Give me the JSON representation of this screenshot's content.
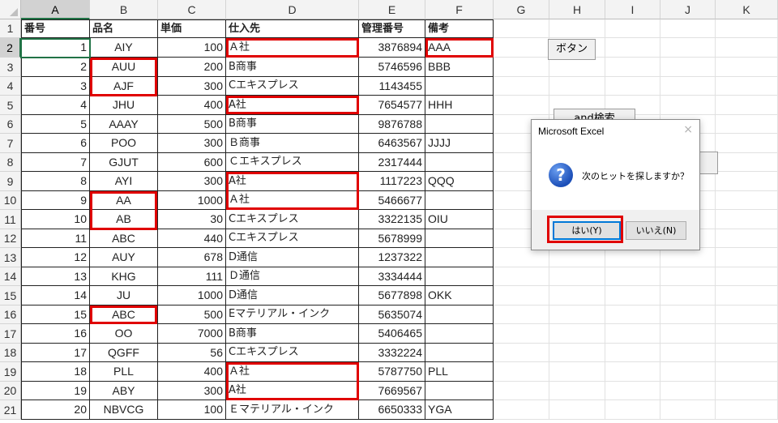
{
  "column_headers": [
    "A",
    "B",
    "C",
    "D",
    "E",
    "F",
    "G",
    "H",
    "I",
    "J",
    "K"
  ],
  "row_headers": [
    "1",
    "2",
    "3",
    "4",
    "5",
    "6",
    "7",
    "8",
    "9",
    "10",
    "11",
    "12",
    "13",
    "14",
    "15",
    "16",
    "17",
    "18",
    "19",
    "20",
    "21"
  ],
  "table": {
    "headers": [
      "番号",
      "品名",
      "単価",
      "仕入先",
      "管理番号",
      "備考"
    ],
    "rows": [
      [
        "1",
        "AIY",
        "100",
        "Ａ社",
        "3876894",
        "AAA"
      ],
      [
        "2",
        "AUU",
        "200",
        "B商事",
        "5746596",
        "BBB"
      ],
      [
        "3",
        "AJF",
        "300",
        "Cエキスプレス",
        "1143455",
        ""
      ],
      [
        "4",
        "JHU",
        "400",
        "A社",
        "7654577",
        "HHH"
      ],
      [
        "5",
        "AAAY",
        "500",
        "B商事",
        "9876788",
        ""
      ],
      [
        "6",
        "POO",
        "300",
        "Ｂ商事",
        "6463567",
        "JJJJ"
      ],
      [
        "7",
        "GJUT",
        "600",
        "Ｃエキスプレス",
        "2317444",
        ""
      ],
      [
        "8",
        "AYI",
        "300",
        "A社",
        "1117223",
        "QQQ"
      ],
      [
        "9",
        "AA",
        "1000",
        "Ａ社",
        "5466677",
        ""
      ],
      [
        "10",
        "AB",
        "30",
        "Cエキスプレス",
        "3322135",
        "OIU"
      ],
      [
        "11",
        "ABC",
        "440",
        "Cエキスプレス",
        "5678999",
        ""
      ],
      [
        "12",
        "AUY",
        "678",
        "D通信",
        "1237322",
        ""
      ],
      [
        "13",
        "KHG",
        "111",
        "Ｄ通信",
        "3334444",
        ""
      ],
      [
        "14",
        "JU",
        "1000",
        "D通信",
        "5677898",
        "OKK"
      ],
      [
        "15",
        "ABC",
        "500",
        "Eマテリアル・インク",
        "5635074",
        ""
      ],
      [
        "16",
        "OO",
        "7000",
        "B商事",
        "5406465",
        ""
      ],
      [
        "17",
        "QGFF",
        "56",
        "Cエキスプレス",
        "3332224",
        ""
      ],
      [
        "18",
        "PLL",
        "400",
        "Ａ社",
        "5787750",
        "PLL"
      ],
      [
        "19",
        "ABY",
        "300",
        "A社",
        "7669567",
        ""
      ],
      [
        "20",
        "NBVCG",
        "100",
        "Ｅマテリアル・インク",
        "6650333",
        "YGA"
      ]
    ]
  },
  "sheet_buttons": {
    "button1_label": "ボタン",
    "button2_label": "and検索"
  },
  "dialog": {
    "title": "Microsoft Excel",
    "close_glyph": "×",
    "icon_glyph": "?",
    "message": "次のヒットを探しますか？",
    "yes_label": "はい(Y)",
    "no_label": "いいえ(N)"
  },
  "colors": {
    "highlight": "#e00000",
    "excel_green": "#217346",
    "question_icon": "#1c4fb8"
  },
  "icons": [
    "question-icon",
    "close-icon"
  ]
}
